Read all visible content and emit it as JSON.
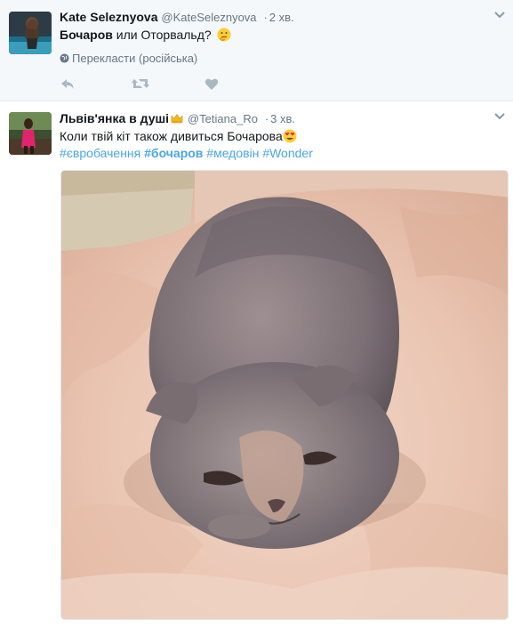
{
  "tweets": [
    {
      "name": "Kate Seleznyova",
      "handle": "@KateSeleznyova",
      "separator": "·",
      "time": "2 хв.",
      "text_bold": "Бочаров",
      "text_rest": " или Оторвальд?",
      "emoji": "thinking-face-emoji",
      "translate_label": "Перекласти (російська)",
      "actions": [
        "reply-icon",
        "retweet-icon",
        "like-icon"
      ]
    },
    {
      "name": "Львів'янка в душі",
      "name_emoji": "crown-emoji",
      "handle": "@Tetiana_Ro",
      "separator": "·",
      "time": "3 хв.",
      "text": "Коли твій кіт також дивиться Бочарова",
      "emoji": "heart-eyes-emoji",
      "hashtags": [
        "#євробачення",
        "#бочаров",
        "#медовін",
        "#Wonder"
      ],
      "media": "cat-photo"
    }
  ],
  "colors": {
    "link": "#48a6e6",
    "muted": "#657786",
    "selected_bg": "#f5f8fa"
  }
}
